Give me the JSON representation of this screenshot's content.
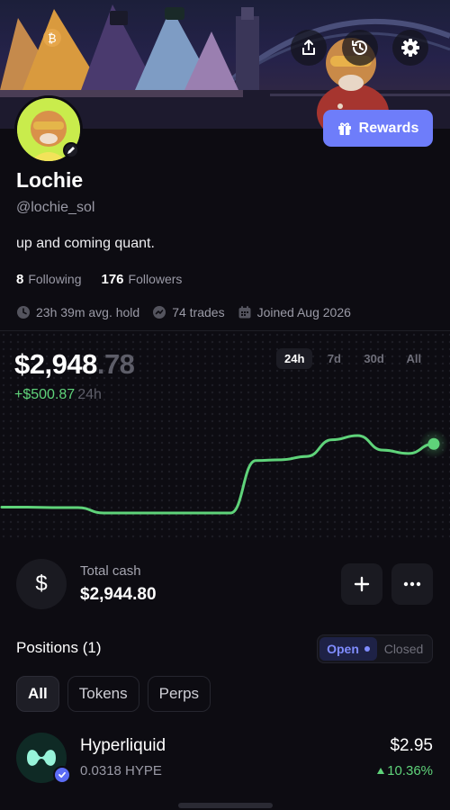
{
  "profile": {
    "name": "Lochie",
    "handle": "@lochie_sol",
    "bio": "up and coming quant.",
    "following_count": "8",
    "following_label": "Following",
    "followers_count": "176",
    "followers_label": "Followers",
    "avg_hold": "23h 39m avg. hold",
    "trades": "74 trades",
    "joined": "Joined Aug 2026"
  },
  "header": {
    "icons": [
      "share-icon",
      "history-icon",
      "gear-icon"
    ],
    "rewards_label": "Rewards"
  },
  "portfolio": {
    "value_whole": "$2,948",
    "value_cents": ".78",
    "change": "+$500.87",
    "change_period": "24h",
    "ranges": [
      "24h",
      "7d",
      "30d",
      "All"
    ],
    "active_range": "24h"
  },
  "chart_data": {
    "type": "line",
    "period": "24h",
    "values": [
      2448,
      2448,
      2447,
      2447,
      2434,
      2434,
      2434,
      2434,
      2434,
      2434,
      2560,
      2562,
      2570,
      2610,
      2620,
      2585,
      2577,
      2600
    ],
    "color": "#5fd37a"
  },
  "cash": {
    "label": "Total cash",
    "value": "$2,944.80",
    "symbol": "$"
  },
  "positions": {
    "title": "Positions (1)",
    "toggle_open": "Open",
    "toggle_closed": "Closed",
    "filters": [
      "All",
      "Tokens",
      "Perps"
    ],
    "active_filter": "All",
    "items": [
      {
        "name": "Hyperliquid",
        "quantity": "0.0318 HYPE",
        "value": "$2.95",
        "change": "10.36%",
        "direction": "up"
      }
    ]
  },
  "colors": {
    "background": "#0d0c12",
    "accent": "#6e7dfa",
    "positive": "#5fd37a",
    "muted": "#9a9aa6"
  }
}
